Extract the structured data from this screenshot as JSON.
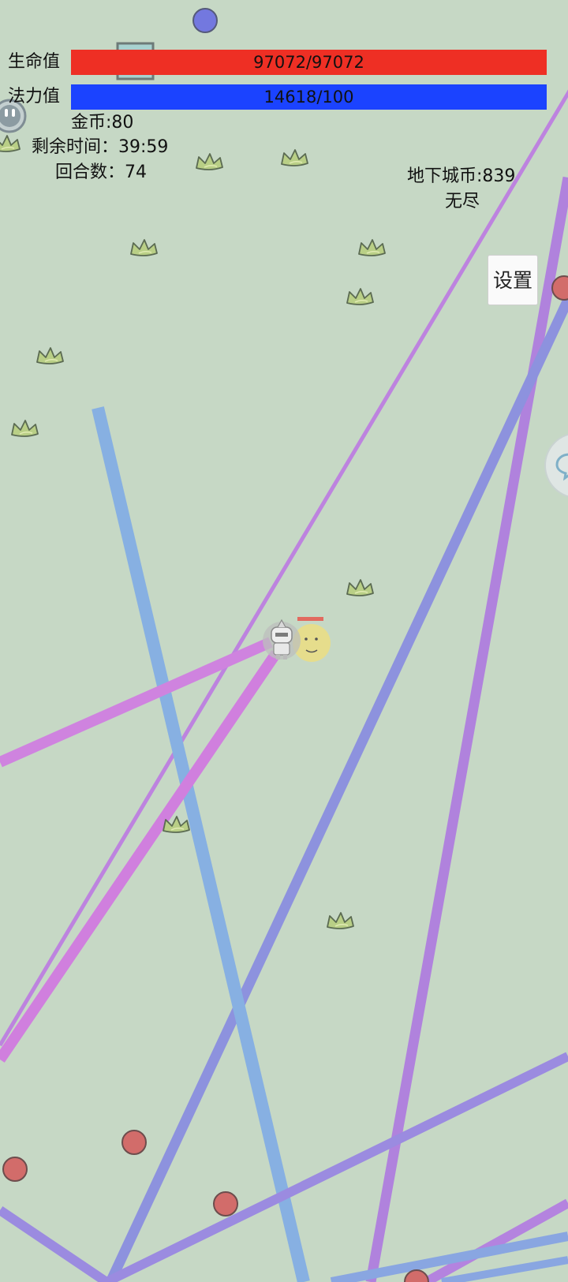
{
  "hud": {
    "hp_label": "生命值",
    "hp_text": "97072/97072",
    "hp_fraction": 1.0,
    "mp_label": "法力值",
    "mp_text": "14618/100",
    "mp_fraction": 1.0,
    "gold": "金币:80",
    "time_remaining": "剩余时间：39:59",
    "round": "回合数：74",
    "dungeon_coins": "地下城币:839",
    "mode": "无尽"
  },
  "settings_button": {
    "label": "设置"
  },
  "colors": {
    "background": "#c6d8c5",
    "hp_bar": "#ee2f24",
    "mp_bar": "#1b43ff",
    "enemy": "#d26c6a",
    "blue_orb": "#7378df",
    "laser_violet": "#b37fe0",
    "laser_blue": "#8ea0df",
    "laser_magenta": "#d27fe0",
    "laser_sky": "#88b3e3",
    "grass": "#b9cf86",
    "companion": "#e6dd8c",
    "player_shield": "#bcbfbc"
  },
  "icons": {
    "grass": "grass-tuft-icon",
    "player": "player-knight-icon",
    "companion": "smiley-companion-icon",
    "chat": "chat-bubble-icon"
  }
}
